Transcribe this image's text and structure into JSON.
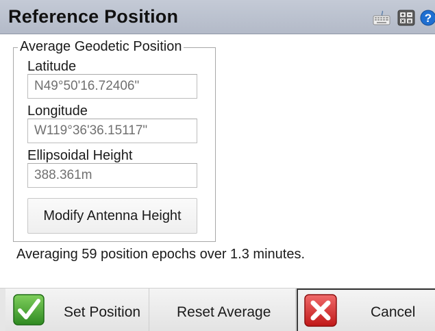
{
  "header": {
    "title": "Reference Position",
    "icons": [
      "keyboard-icon",
      "calculator-icon",
      "help-icon"
    ]
  },
  "group": {
    "legend": "Average Geodetic Position",
    "latitude": {
      "label": "Latitude",
      "value": "N49°50'16.72406\""
    },
    "longitude": {
      "label": "Longitude",
      "value": "W119°36'36.15117\""
    },
    "height": {
      "label": "Ellipsoidal Height",
      "value": "388.361m"
    },
    "modify_label": "Modify Antenna Height"
  },
  "status": "Averaging 59 position epochs over 1.3 minutes.",
  "footer": {
    "set_label": "Set Position",
    "reset_label": "Reset Average",
    "cancel_label": "Cancel"
  },
  "colors": {
    "titlebar": "#b9c0cd",
    "check_green": "#3f9a2e",
    "cancel_red": "#d82a2a",
    "help_blue": "#1f6fd1"
  }
}
